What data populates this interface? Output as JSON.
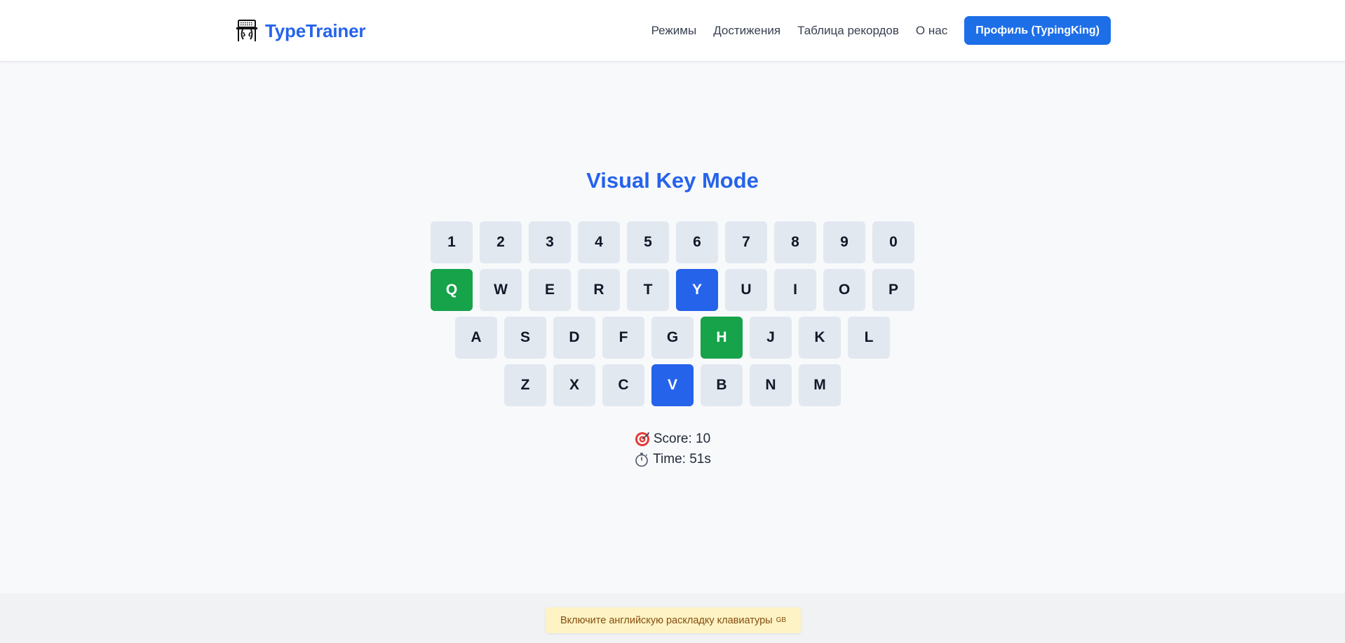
{
  "header": {
    "brand_name": "TypeTrainer",
    "nav": [
      "Режимы",
      "Достижения",
      "Таблица рекордов",
      "О нас"
    ],
    "profile_button": "Профиль (TypingKing)"
  },
  "main": {
    "title": "Visual Key Mode",
    "keyboard_rows": [
      [
        "1",
        "2",
        "3",
        "4",
        "5",
        "6",
        "7",
        "8",
        "9",
        "0"
      ],
      [
        "Q",
        "W",
        "E",
        "R",
        "T",
        "Y",
        "U",
        "I",
        "O",
        "P"
      ],
      [
        "A",
        "S",
        "D",
        "F",
        "G",
        "H",
        "J",
        "K",
        "L"
      ],
      [
        "Z",
        "X",
        "C",
        "V",
        "B",
        "N",
        "M"
      ]
    ],
    "highlighted_green": [
      "Q",
      "H"
    ],
    "highlighted_blue": [
      "Y",
      "V"
    ],
    "score_text": "Score: 10",
    "time_text": "Time: 51s"
  },
  "footer": {
    "notice_text": "Включите английскую раскладку клавиатуры",
    "notice_badge": "GB"
  },
  "colors": {
    "accent_blue": "#2563eb",
    "highlight_green": "#16a34a",
    "key_bg": "#e2e8f0",
    "notice_bg": "#fdf3c4"
  },
  "icons": {
    "brand": "typing-keyboard-icon",
    "score": "target-icon",
    "time": "stopwatch-icon"
  }
}
